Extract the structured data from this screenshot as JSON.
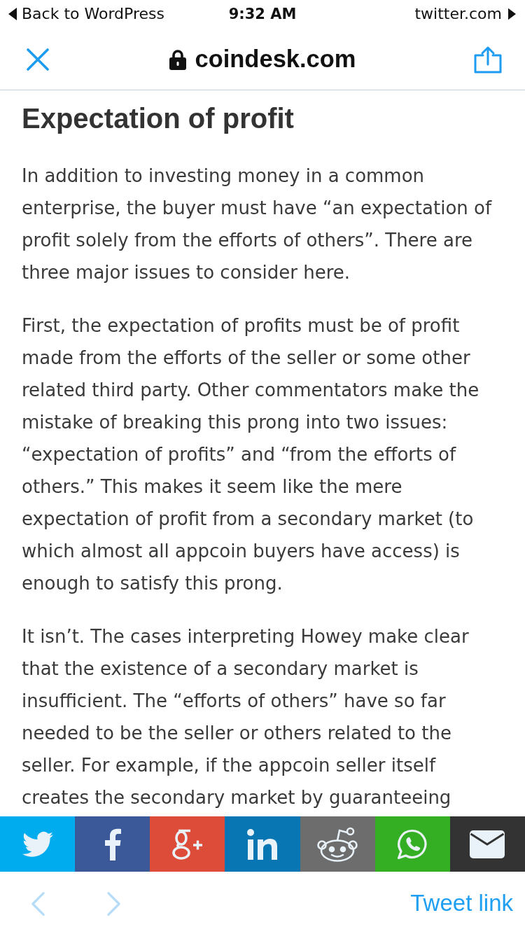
{
  "status_bar": {
    "back_label": "Back to WordPress",
    "time": "9:32 AM",
    "forward_label": "twitter.com"
  },
  "nav_bar": {
    "secure": true,
    "domain": "coindesk.com"
  },
  "article": {
    "heading": "Expectation of profit",
    "paragraphs": [
      "In addition to investing money in a common enterprise, the buyer must have “an expectation of profit solely from the efforts of others”. There are three major issues to consider here.",
      "First, the expectation of profits must be of profit made from the efforts of the seller or some other related third party. Other commentators make the mistake of breaking this prong into two issues: “expectation of profits” and “from the efforts of others.” This makes it seem like the mere expectation of profit from a secondary market (to which almost all appcoin buyers have access) is enough to satisfy this prong.",
      "It isn’t. The cases interpreting Howey make clear that the existence of a secondary market is insufficient. The “efforts of others” have so far needed to be the seller or others related to the seller. For example, if the appcoin seller itself creates the secondary market by guaranteeing"
    ]
  },
  "share_buttons": [
    {
      "kind": "twitter",
      "color": "#00acee"
    },
    {
      "kind": "facebook",
      "color": "#3b5998"
    },
    {
      "kind": "google_plus",
      "color": "#dd4b39"
    },
    {
      "kind": "linkedin",
      "color": "#0976b4"
    },
    {
      "kind": "reddit",
      "color": "#6d6d6d"
    },
    {
      "kind": "whatsapp",
      "color": "#34af23"
    },
    {
      "kind": "email",
      "color": "#333333"
    }
  ],
  "toolbar": {
    "back": {
      "disabled": true
    },
    "forward": {
      "disabled": true
    },
    "action": "Tweet link"
  }
}
